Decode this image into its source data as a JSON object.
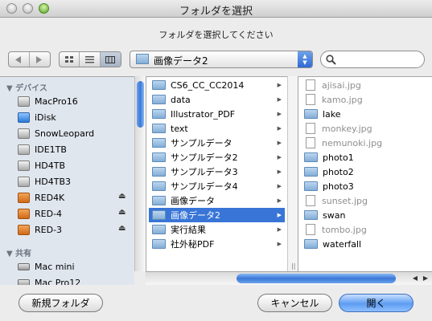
{
  "window": {
    "title": "フォルダを選択"
  },
  "prompt": "フォルダを選択してください",
  "toolbar": {
    "back_icon": "triangle-left-icon",
    "forward_icon": "triangle-right-icon",
    "view_icons": [
      "icon-view-icon",
      "list-view-icon",
      "column-view-icon"
    ],
    "active_view": "column-view",
    "location": "画像データ2",
    "search": {
      "value": "",
      "placeholder": ""
    }
  },
  "sidebar": {
    "devices_header": "デバイス",
    "devices": [
      {
        "label": "MacPro16",
        "icon": "hard-disk-icon"
      },
      {
        "label": "iDisk",
        "icon": "idisk-icon"
      },
      {
        "label": "SnowLeopard",
        "icon": "hard-disk-icon"
      },
      {
        "label": "IDE1TB",
        "icon": "hard-disk-icon"
      },
      {
        "label": "HD4TB",
        "icon": "hard-disk-icon"
      },
      {
        "label": "HD4TB3",
        "icon": "hard-disk-icon"
      },
      {
        "label": "RED4K",
        "icon": "removable-disk-icon",
        "eject": true
      },
      {
        "label": "RED-4",
        "icon": "removable-disk-icon",
        "eject": true
      },
      {
        "label": "RED-3",
        "icon": "removable-disk-icon",
        "eject": true
      }
    ],
    "shared_header": "共有",
    "shared": [
      {
        "label": "Mac mini",
        "icon": "computer-icon"
      },
      {
        "label": "Mac Pro12",
        "icon": "computer-icon"
      }
    ]
  },
  "column1": [
    {
      "label": "CS6_CC_CC2014"
    },
    {
      "label": "data"
    },
    {
      "label": "Illustrator_PDF"
    },
    {
      "label": "text"
    },
    {
      "label": "サンプルデータ"
    },
    {
      "label": "サンプルデータ2"
    },
    {
      "label": "サンプルデータ3"
    },
    {
      "label": "サンプルデータ4"
    },
    {
      "label": "画像データ"
    },
    {
      "label": "画像データ2",
      "selected": true
    },
    {
      "label": "実行結果"
    },
    {
      "label": "社外秘PDF"
    }
  ],
  "column2": [
    {
      "label": "ajisai.jpg",
      "type": "file"
    },
    {
      "label": "kamo.jpg",
      "type": "file"
    },
    {
      "label": "lake",
      "type": "folder"
    },
    {
      "label": "monkey.jpg",
      "type": "file"
    },
    {
      "label": "nemunoki.jpg",
      "type": "file"
    },
    {
      "label": "photo1",
      "type": "folder"
    },
    {
      "label": "photo2",
      "type": "folder"
    },
    {
      "label": "photo3",
      "type": "folder"
    },
    {
      "label": "sunset.jpg",
      "type": "file"
    },
    {
      "label": "swan",
      "type": "folder"
    },
    {
      "label": "tombo.jpg",
      "type": "file"
    },
    {
      "label": "waterfall",
      "type": "folder"
    }
  ],
  "buttons": {
    "new_folder": "新規フォルダ",
    "cancel": "キャンセル",
    "open": "開く"
  },
  "colors": {
    "selection": "#3875d7",
    "sidebar_bg": "#e0e6ee",
    "default_button": "#5d9cf2"
  }
}
